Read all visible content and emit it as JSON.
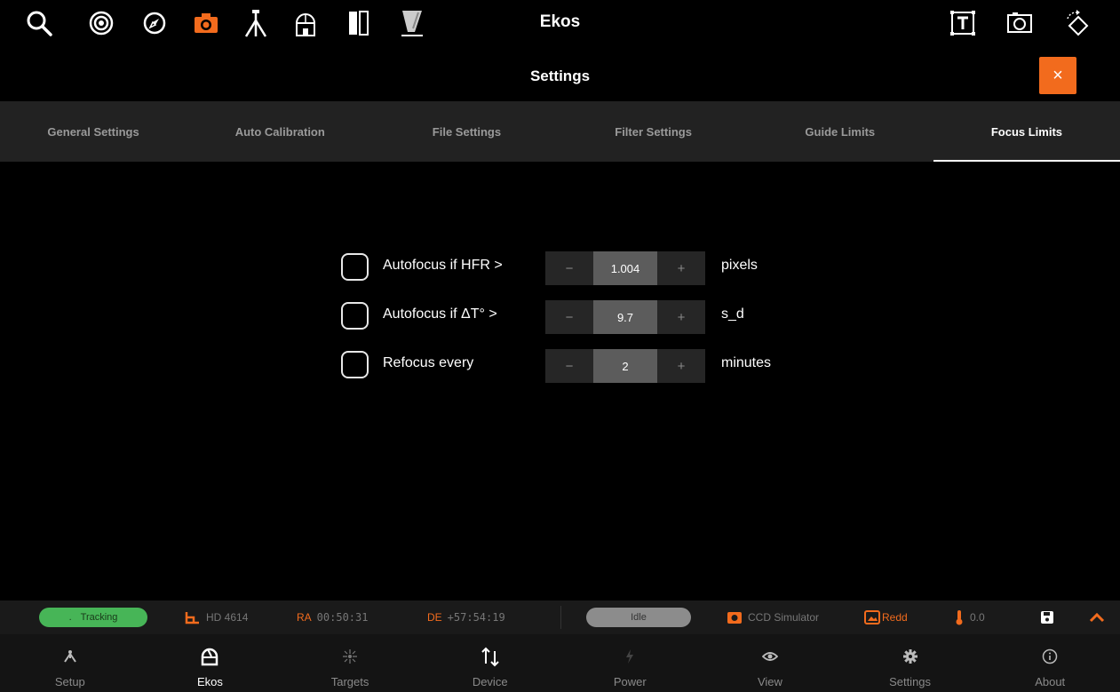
{
  "app": {
    "title": "Ekos"
  },
  "toolbar": {
    "icons": [
      "search-icon",
      "target-icon",
      "compass-icon",
      "camera-icon",
      "tripod-icon",
      "observatory-icon",
      "filter-icon",
      "focuser-icon",
      "text-icon",
      "frame-icon",
      "rotate-icon"
    ],
    "active_icon": "camera-icon",
    "accent_color": "#f26b1d"
  },
  "settings": {
    "title": "Settings",
    "close_label": "×"
  },
  "tabs": [
    {
      "label": "General Settings"
    },
    {
      "label": "Auto Calibration"
    },
    {
      "label": "File Settings"
    },
    {
      "label": "Filter Settings"
    },
    {
      "label": "Guide Limits"
    },
    {
      "label": "Focus Limits",
      "active": true
    }
  ],
  "form": {
    "rows": [
      {
        "label": "Autofocus if HFR >",
        "value": "1.004",
        "unit": "pixels",
        "checked": false
      },
      {
        "label": "Autofocus if ΔT° >",
        "value": "9.7",
        "unit": "s_d",
        "checked": false
      },
      {
        "label": "Refocus every",
        "value": "2",
        "unit": "minutes",
        "checked": false
      }
    ],
    "minus_label": "−",
    "plus_label": "+"
  },
  "status": {
    "tracking_dot": ".",
    "tracking": "Tracking",
    "target_name": "HD 4614",
    "ra_label": "RA",
    "ra_value": "00:50:31",
    "de_label": "DE",
    "de_value": "+57:54:19",
    "idle": "Idle",
    "camera": "CCD Simulator",
    "filter": "Redd",
    "temperature": "0.0",
    "tracking_color": "#47b557"
  },
  "nav": [
    {
      "label": "Setup",
      "icon": "setup-icon"
    },
    {
      "label": "Ekos",
      "icon": "ekos-icon",
      "active": true
    },
    {
      "label": "Targets",
      "icon": "targets-icon"
    },
    {
      "label": "Device",
      "icon": "device-icon"
    },
    {
      "label": "Power",
      "icon": "power-icon"
    },
    {
      "label": "View",
      "icon": "view-icon"
    },
    {
      "label": "Settings",
      "icon": "settings-icon"
    },
    {
      "label": "About",
      "icon": "about-icon"
    }
  ]
}
